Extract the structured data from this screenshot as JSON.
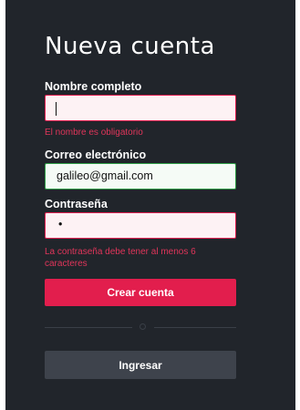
{
  "form": {
    "title": "Nueva cuenta",
    "name": {
      "label": "Nombre completo",
      "value": "",
      "error": "El nombre es obligatorio"
    },
    "email": {
      "label": "Correo electrónico",
      "value": "galileo@gmail.com"
    },
    "password": {
      "label": "Contraseña",
      "masked_value": "•",
      "error": "La contraseña debe tener al menos 6 caracteres"
    },
    "submit_label": "Crear cuenta",
    "login_label": "Ingresar"
  },
  "colors": {
    "panel_bg": "#21252b",
    "accent": "#e21e4d",
    "error": "#e0355a",
    "success_border": "#2f9e47",
    "secondary_button": "#3e434c"
  }
}
